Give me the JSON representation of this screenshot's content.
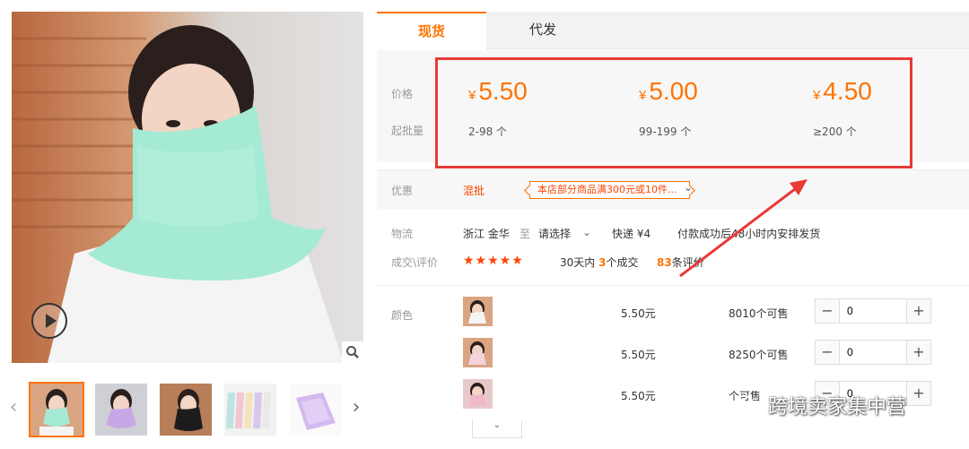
{
  "gallery": {
    "main_image": "product-photo-woman-wearing-mint-sun-protection-face-mask",
    "thumbs": [
      {
        "name": "mint-mask-thumb"
      },
      {
        "name": "purple-mask-thumb"
      },
      {
        "name": "black-mask-thumb"
      },
      {
        "name": "color-options-thumb"
      },
      {
        "name": "lavender-mask-thumb"
      }
    ],
    "prev_arrow": "‹",
    "next_arrow": "›"
  },
  "tabs": [
    {
      "label": "现货"
    },
    {
      "label": "代发"
    }
  ],
  "price": {
    "price_label": "价格",
    "moq_label": "起批量",
    "currency": "¥",
    "tiers": [
      {
        "price": "5.50",
        "qty": "2-98 个"
      },
      {
        "price": "5.00",
        "qty": "99-199 个"
      },
      {
        "price": "4.50",
        "qty": "≥200 个"
      }
    ]
  },
  "promo": {
    "label": "优惠",
    "tag": "混批",
    "coupon": "本店部分商品满300元或10件...",
    "chevron": "⌄"
  },
  "logistics": {
    "label": "物流",
    "origin": "浙江 金华",
    "to": "至",
    "destination": "请选择",
    "express": "快递 ¥4",
    "shipping_note": "付款成功后48小时内安排发货"
  },
  "reviews": {
    "label": "成交\\评价",
    "stars": "★★★★★",
    "sales_prefix": "30天内",
    "sales_count": "3",
    "sales_suffix": "个成交",
    "review_count": "83",
    "review_suffix": "条评价"
  },
  "sku": {
    "label": "颜色",
    "rows": [
      {
        "price": "5.50元",
        "stock": "8010个可售",
        "qty": "0"
      },
      {
        "price": "5.50元",
        "stock": "8250个可售",
        "qty": "0"
      },
      {
        "price": "5.50元",
        "stock": "个可售",
        "qty": "0"
      }
    ],
    "minus": "−",
    "plus": "+",
    "more": "⌄"
  },
  "watermark": "跨境卖家集中营",
  "colors": {
    "accent": "#ff7300",
    "highlight_box": "#e83a36",
    "mask_mint": "#9fe8d0"
  }
}
